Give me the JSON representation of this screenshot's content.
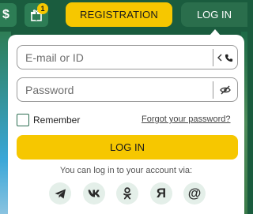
{
  "header": {
    "balance_icon_glyph": "$",
    "gift_badge_count": "1",
    "registration_label": "REGISTRATION",
    "login_label": "LOG IN"
  },
  "login_form": {
    "email_placeholder": "E-mail or ID",
    "email_value": "",
    "password_placeholder": "Password",
    "password_value": "",
    "remember_label": "Remember",
    "remember_checked": false,
    "forgot_label": "Forgot your password?",
    "submit_label": "LOG IN",
    "social_prompt": "You can log in to your account via:",
    "social": [
      {
        "name": "telegram",
        "glyph": ""
      },
      {
        "name": "vk",
        "glyph": ""
      },
      {
        "name": "odnoklassniki",
        "glyph": ""
      },
      {
        "name": "yandex",
        "glyph": "Я"
      },
      {
        "name": "email",
        "glyph": "@"
      }
    ]
  },
  "colors": {
    "header_bg": "#1a5c3e",
    "accent_yellow": "#f6c700",
    "panel_bg": "#ffffff",
    "social_bg": "#e4efe9"
  }
}
